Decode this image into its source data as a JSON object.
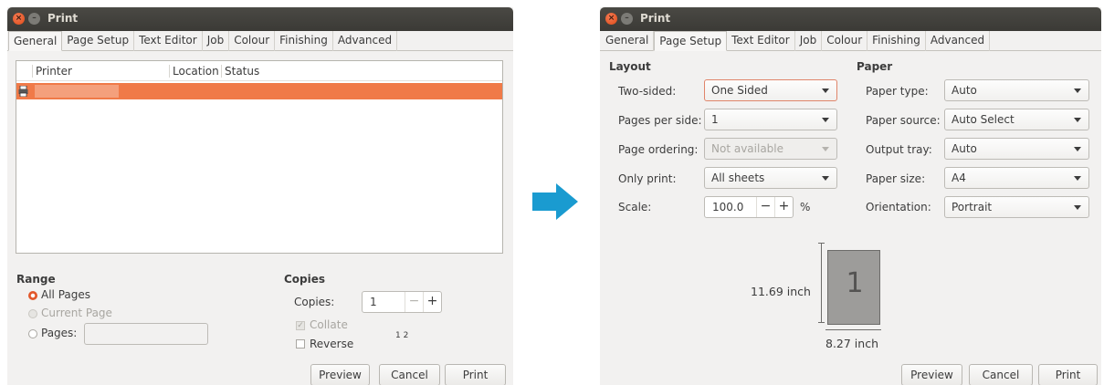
{
  "left_window": {
    "title": "Print",
    "tabs": [
      "General",
      "Page Setup",
      "Text Editor",
      "Job",
      "Colour",
      "Finishing",
      "Advanced"
    ],
    "active_tab": "General",
    "printer_list": {
      "columns": [
        "Printer",
        "Location",
        "Status"
      ],
      "selected_row": {
        "printer": "",
        "location": "",
        "status": ""
      }
    },
    "range": {
      "title": "Range",
      "all_pages": "All Pages",
      "current_page": "Current Page",
      "pages_label": "Pages:",
      "pages_value": ""
    },
    "copies": {
      "title": "Copies",
      "copies_label": "Copies:",
      "copies_value": "1",
      "collate_label": "Collate",
      "reverse_label": "Reverse",
      "collate_preview": "1 2"
    },
    "buttons": {
      "preview": "Preview",
      "cancel": "Cancel",
      "print": "Print"
    }
  },
  "right_window": {
    "title": "Print",
    "tabs": [
      "General",
      "Page Setup",
      "Text Editor",
      "Job",
      "Colour",
      "Finishing",
      "Advanced"
    ],
    "active_tab": "Page Setup",
    "layout": {
      "title": "Layout",
      "two_sided_label": "Two-sided:",
      "two_sided_value": "One Sided",
      "pages_per_side_label": "Pages per side:",
      "pages_per_side_value": "1",
      "page_ordering_label": "Page ordering:",
      "page_ordering_value": "Not available",
      "only_print_label": "Only print:",
      "only_print_value": "All sheets",
      "scale_label": "Scale:",
      "scale_value": "100.0",
      "scale_unit": "%"
    },
    "paper": {
      "title": "Paper",
      "paper_type_label": "Paper type:",
      "paper_type_value": "Auto",
      "paper_source_label": "Paper source:",
      "paper_source_value": "Auto Select",
      "output_tray_label": "Output tray:",
      "output_tray_value": "Auto",
      "paper_size_label": "Paper size:",
      "paper_size_value": "A4",
      "orientation_label": "Orientation:",
      "orientation_value": "Portrait"
    },
    "preview": {
      "page_number": "1",
      "height": "11.69 inch",
      "width": "8.27 inch"
    },
    "buttons": {
      "preview": "Preview",
      "cancel": "Cancel",
      "print": "Print"
    }
  },
  "colors": {
    "accent": "#f07a48",
    "arrow": "#1a9bd0",
    "titlebar": "#3f3e3a",
    "close": "#e2572a"
  }
}
